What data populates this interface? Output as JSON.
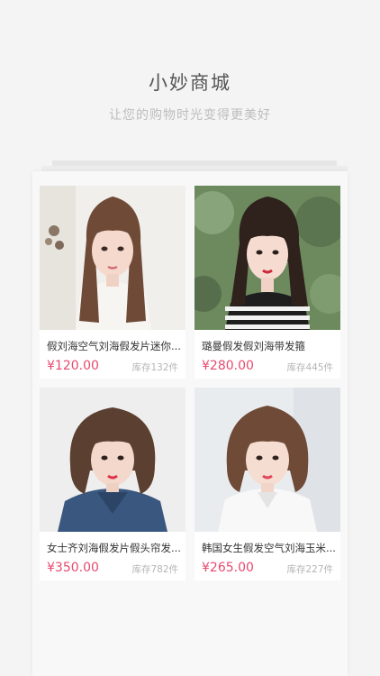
{
  "header": {
    "title": "小妙商城",
    "subtitle": "让您的购物时光变得更美好"
  },
  "currency_symbol": "¥",
  "products": [
    {
      "name": "假刘海空气刘海假发片迷你...",
      "price": "¥120.00",
      "stock": "库存132件",
      "image": "portrait-long-hair-bangs-white-top"
    },
    {
      "name": "璐曼假发假刘海带发箍",
      "price": "¥280.00",
      "stock": "库存445件",
      "image": "portrait-long-hair-striped-top"
    },
    {
      "name": "女士齐刘海假发片假头帘发...",
      "price": "¥350.00",
      "stock": "库存782件",
      "image": "portrait-bob-hair-denim-jacket"
    },
    {
      "name": "韩国女生假发空气刘海玉米...",
      "price": "¥265.00",
      "stock": "库存227件",
      "image": "portrait-bob-hair-white-shirt"
    }
  ],
  "colors": {
    "price": "#e84a6f",
    "background": "#f4f4f4"
  }
}
